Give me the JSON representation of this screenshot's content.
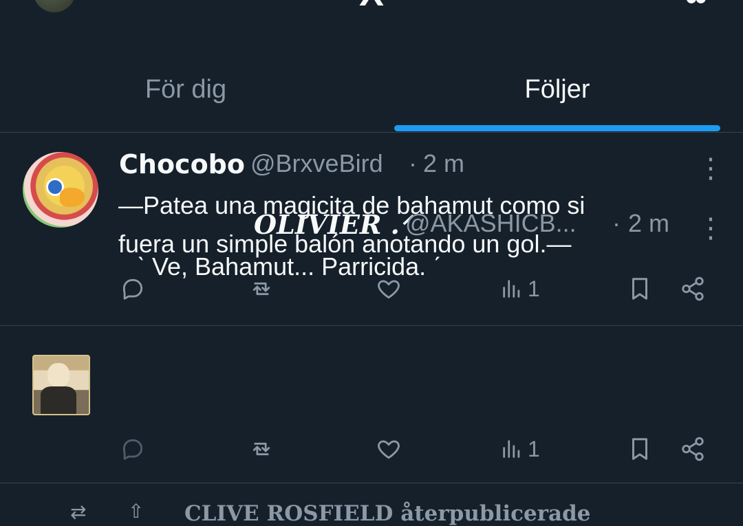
{
  "top": {
    "logo": "X",
    "gear": "✿"
  },
  "tabs": [
    {
      "label": "För dig"
    },
    {
      "label": "Följer"
    }
  ],
  "posts": [
    {
      "display_name": "Chocobo",
      "handle": "@BrxveBird",
      "separator": "·",
      "time": "2 m",
      "text": "—Patea una magicita de bahamut como si\nfuera un simple balón anotando un gol.—",
      "views": "1"
    },
    {
      "display_name": "OLIVIER .ᐟ",
      "handle": "@AKASHICB...",
      "separator": "·",
      "time": "2 m",
      "text": "ˋ Ve, Bahamut... Parricida. ˊ",
      "views": "1"
    }
  ],
  "bottom": {
    "text": "CLIVE ROSFIELD återpublicerade"
  },
  "icons": {
    "more": "more-icon",
    "reply": "reply-icon",
    "repost": "repost-icon",
    "like": "heart-icon",
    "views": "views-icon",
    "bookmark": "bookmark-icon",
    "share": "share-icon"
  },
  "colors": {
    "background": "#15202b",
    "primary_text": "#f7f9f9",
    "secondary_text": "#8b98a5",
    "accent": "#1d9bf0",
    "divider": "#38444d"
  }
}
